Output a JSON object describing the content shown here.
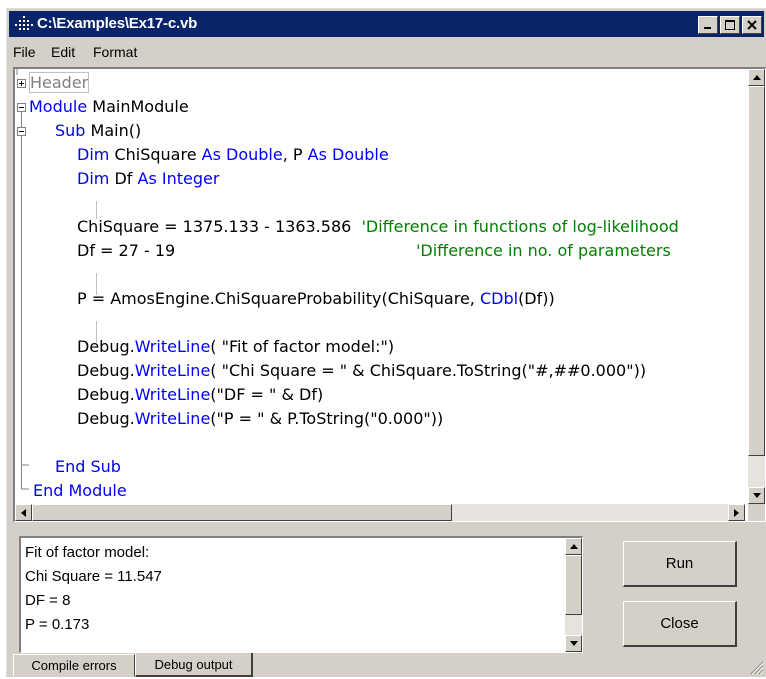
{
  "window": {
    "title": "C:\\Examples\\Ex17-c.vb",
    "minimize_label": "_",
    "maximize_label": "□",
    "close_label": "✕"
  },
  "menu": [
    "File",
    "Edit",
    "Format"
  ],
  "code": {
    "header_label": "Header",
    "module_kw": "Module",
    "module_name": "MainModule",
    "sub_kw": "Sub",
    "sub_name": "Main()",
    "dim1_kw": "Dim",
    "dim1_name1": "ChiSquare",
    "dim1_as1": "As Double",
    "dim1_comma": ", P",
    "dim1_as2": "As Double",
    "dim2_kw": "Dim",
    "dim2_name": "Df",
    "dim2_as": "As Integer",
    "chisq_stmt": "ChiSquare = 1375.133 - 1363.586",
    "chisq_comment": "'Difference in functions of log-likelihood",
    "df_stmt": "Df = 27 - 19",
    "df_comment": "'Difference in no. of parameters",
    "p_stmt_a": "P = AmosEngine.ChiSquareProbability(ChiSquare, ",
    "p_stmt_kw": "CDbl",
    "p_stmt_b": "(Df))",
    "debug_obj": "Debug.",
    "writeline": "WriteLine",
    "wl1_args": "( \"Fit of factor model:\")",
    "wl2_args": "( \"Chi Square = \" & ChiSquare.ToString(\"#,##0.000\"))",
    "wl3_args": "(\"DF = \" & Df)",
    "wl4_args": "(\"P = \" & P.ToString(\"0.000\"))",
    "end_sub": "End Sub",
    "end_module": "End Module"
  },
  "output_lines": [
    "Fit of factor model:",
    "Chi Square = 11.547",
    "DF = 8",
    "P = 0.173"
  ],
  "buttons": {
    "run": "Run",
    "close": "Close"
  },
  "tabs": {
    "compile_errors": "Compile errors",
    "debug_output": "Debug output"
  }
}
